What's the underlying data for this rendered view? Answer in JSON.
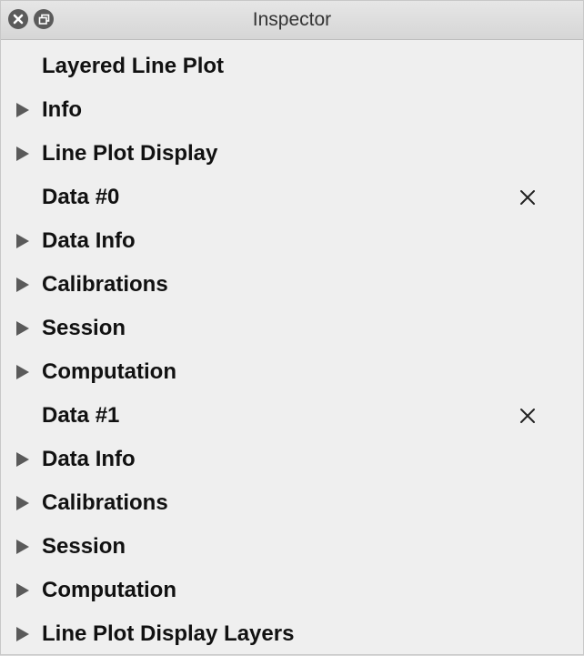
{
  "window": {
    "title": "Inspector"
  },
  "titlebar_buttons": {
    "close_icon": "close-icon",
    "float_icon": "restore-window-icon"
  },
  "inspector": {
    "heading": "Layered Line Plot",
    "rows": [
      {
        "label": "Info",
        "type": "section"
      },
      {
        "label": "Line Plot Display",
        "type": "section"
      },
      {
        "label": "Data #0",
        "type": "data-header"
      },
      {
        "label": "Data Info",
        "type": "section"
      },
      {
        "label": "Calibrations",
        "type": "section"
      },
      {
        "label": "Session",
        "type": "section"
      },
      {
        "label": "Computation",
        "type": "section"
      },
      {
        "label": "Data #1",
        "type": "data-header"
      },
      {
        "label": "Data Info",
        "type": "section"
      },
      {
        "label": "Calibrations",
        "type": "section"
      },
      {
        "label": "Session",
        "type": "section"
      },
      {
        "label": "Computation",
        "type": "section"
      },
      {
        "label": "Line Plot Display Layers",
        "type": "section"
      }
    ]
  },
  "colors": {
    "background": "#efefef",
    "titlebar": "#d9d9d9",
    "text": "#111111",
    "disclosure": "#5a5a5a"
  }
}
